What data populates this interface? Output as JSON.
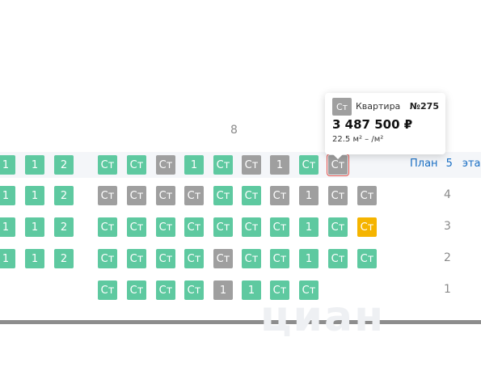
{
  "section": {
    "label": "8"
  },
  "colors": {
    "available": "#5ec9a0",
    "unavailable": "#9f9f9f",
    "highlight": "#f5b400",
    "link": "#1a6fc4"
  },
  "floors": [
    {
      "floor": "5",
      "plan_label": "План",
      "etazh_label": "этаж",
      "cells": [
        {
          "label": "1",
          "status": "green"
        },
        {
          "label": "1",
          "status": "green"
        },
        {
          "label": "2",
          "status": "green"
        },
        {
          "label": "Ст",
          "status": "green"
        },
        {
          "label": "Ст",
          "status": "green"
        },
        {
          "label": "Ст",
          "status": "gray"
        },
        {
          "label": "1",
          "status": "green"
        },
        {
          "label": "Ст",
          "status": "green"
        },
        {
          "label": "Ст",
          "status": "gray"
        },
        {
          "label": "1",
          "status": "gray"
        },
        {
          "label": "Ст",
          "status": "green"
        },
        {
          "label": "Ст",
          "status": "gray"
        }
      ]
    },
    {
      "floor": "4",
      "cells": [
        {
          "label": "1",
          "status": "green"
        },
        {
          "label": "1",
          "status": "green"
        },
        {
          "label": "2",
          "status": "green"
        },
        {
          "label": "Ст",
          "status": "gray"
        },
        {
          "label": "Ст",
          "status": "gray"
        },
        {
          "label": "Ст",
          "status": "gray"
        },
        {
          "label": "Ст",
          "status": "gray"
        },
        {
          "label": "Ст",
          "status": "green"
        },
        {
          "label": "Ст",
          "status": "green"
        },
        {
          "label": "Ст",
          "status": "gray"
        },
        {
          "label": "1",
          "status": "gray"
        },
        {
          "label": "Ст",
          "status": "gray"
        },
        {
          "label": "Ст",
          "status": "gray"
        }
      ]
    },
    {
      "floor": "3",
      "cells": [
        {
          "label": "1",
          "status": "green"
        },
        {
          "label": "1",
          "status": "green"
        },
        {
          "label": "2",
          "status": "green"
        },
        {
          "label": "Ст",
          "status": "green"
        },
        {
          "label": "Ст",
          "status": "green"
        },
        {
          "label": "Ст",
          "status": "green"
        },
        {
          "label": "Ст",
          "status": "green"
        },
        {
          "label": "Ст",
          "status": "green"
        },
        {
          "label": "Ст",
          "status": "green"
        },
        {
          "label": "Ст",
          "status": "green"
        },
        {
          "label": "1",
          "status": "green"
        },
        {
          "label": "Ст",
          "status": "green"
        },
        {
          "label": "Ст",
          "status": "yellow"
        }
      ]
    },
    {
      "floor": "2",
      "cells": [
        {
          "label": "1",
          "status": "green"
        },
        {
          "label": "1",
          "status": "green"
        },
        {
          "label": "2",
          "status": "green"
        },
        {
          "label": "Ст",
          "status": "green"
        },
        {
          "label": "Ст",
          "status": "green"
        },
        {
          "label": "Ст",
          "status": "green"
        },
        {
          "label": "Ст",
          "status": "green"
        },
        {
          "label": "Ст",
          "status": "gray"
        },
        {
          "label": "Ст",
          "status": "green"
        },
        {
          "label": "Ст",
          "status": "green"
        },
        {
          "label": "1",
          "status": "green"
        },
        {
          "label": "Ст",
          "status": "green"
        },
        {
          "label": "Ст",
          "status": "green"
        }
      ]
    },
    {
      "floor": "1",
      "cells": [
        {
          "label": "Ст",
          "status": "green"
        },
        {
          "label": "Ст",
          "status": "green"
        },
        {
          "label": "Ст",
          "status": "green"
        },
        {
          "label": "Ст",
          "status": "green"
        },
        {
          "label": "1",
          "status": "gray"
        },
        {
          "label": "1",
          "status": "green"
        },
        {
          "label": "Ст",
          "status": "green"
        },
        {
          "label": "Ст",
          "status": "green"
        }
      ]
    }
  ],
  "tooltip": {
    "badge": "Ст",
    "type": "Квартира",
    "number": "№275",
    "price": "3 487 500 ₽",
    "area": "22.5 м² – /м²"
  },
  "watermark": "циан"
}
